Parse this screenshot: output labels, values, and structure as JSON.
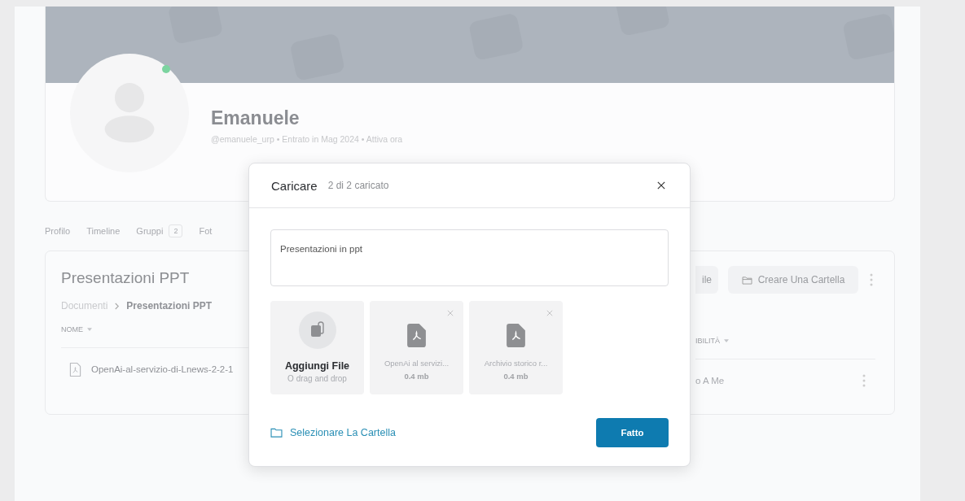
{
  "profile": {
    "name": "Emanuele",
    "meta": "@emanuele_urp • Entrato in Mag 2024 • Attiva ora",
    "online": true
  },
  "tabs": [
    {
      "label": "Profilo",
      "selected": false
    },
    {
      "label": "Timeline",
      "selected": false
    },
    {
      "label": "Gruppi",
      "count": "2",
      "selected": false
    },
    {
      "label": "Fot",
      "selected": false
    }
  ],
  "documents": {
    "title": "Presentazioni PPT",
    "breadcrumb": [
      "Documenti",
      "Presentazioni PPT"
    ],
    "actions": [
      {
        "label": "ile",
        "kind": "plain"
      },
      {
        "label": "Creare Una Cartella",
        "kind": "folder"
      }
    ],
    "columns": [
      "NOME",
      "IBILITÀ"
    ],
    "rows": [
      {
        "name": "OpenAi-al-servizio-di-Lnews-2-2-1",
        "visibility": "o A Me"
      }
    ]
  },
  "modal": {
    "title": "Caricare",
    "status": "2 di 2 caricato",
    "description": "Presentazioni in ppt",
    "add_tile": {
      "title": "Aggiungi File",
      "subtitle": "O drag and drop"
    },
    "files": [
      {
        "name": "OpenAi al servizi...",
        "size": "0.4 mb"
      },
      {
        "name": "Archivio storico r...",
        "size": "0.4 mb"
      }
    ],
    "folder_link": "Selezionare La Cartella",
    "done": "Fatto"
  }
}
